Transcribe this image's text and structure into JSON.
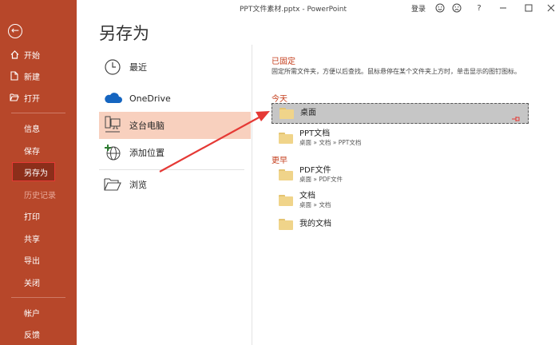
{
  "window": {
    "title": "PPT文件素材.pptx  -  PowerPoint",
    "login": "登录",
    "icons": [
      "smiley-icon",
      "frown-icon",
      "help-icon",
      "minimize-icon",
      "maximize-icon",
      "close-icon"
    ]
  },
  "sidebar": {
    "bg_color": "#b7472a",
    "items": [
      {
        "label": "开始"
      },
      {
        "label": "新建"
      },
      {
        "label": "打开"
      },
      {
        "label": "信息"
      },
      {
        "label": "保存"
      },
      {
        "label": "另存为"
      },
      {
        "label": "历史记录"
      },
      {
        "label": "打印"
      },
      {
        "label": "共享"
      },
      {
        "label": "导出"
      },
      {
        "label": "关闭"
      },
      {
        "label": "帐户"
      },
      {
        "label": "反馈"
      }
    ]
  },
  "page": {
    "title": "另存为"
  },
  "locations": [
    {
      "label": "最近",
      "icon": "clock-icon"
    },
    {
      "label": "OneDrive",
      "icon": "cloud-icon"
    },
    {
      "label": "这台电脑",
      "icon": "computer-icon"
    },
    {
      "label": "添加位置",
      "icon": "add-location-icon"
    },
    {
      "label": "浏览",
      "icon": "open-folder-icon"
    }
  ],
  "pinned": {
    "heading": "已固定",
    "description": "固定所需文件夹，方便以后查找。鼠标悬停在某个文件夹上方时，单击显示的图钉图标。"
  },
  "today": {
    "heading": "今天",
    "folders": [
      {
        "name": "桌面",
        "path": ""
      },
      {
        "name": "PPT文档",
        "path": "桌面 » 文档 » PPT文档"
      }
    ]
  },
  "earlier": {
    "heading": "更早",
    "folders": [
      {
        "name": "PDF文件",
        "path": "桌面 » PDF文件"
      },
      {
        "name": "文档",
        "path": "桌面 » 文档"
      },
      {
        "name": "我的文档",
        "path": ""
      }
    ]
  },
  "colors": {
    "accent": "#c43e1c",
    "annotation": "#e53935",
    "selected_location": "#f8d0be"
  }
}
